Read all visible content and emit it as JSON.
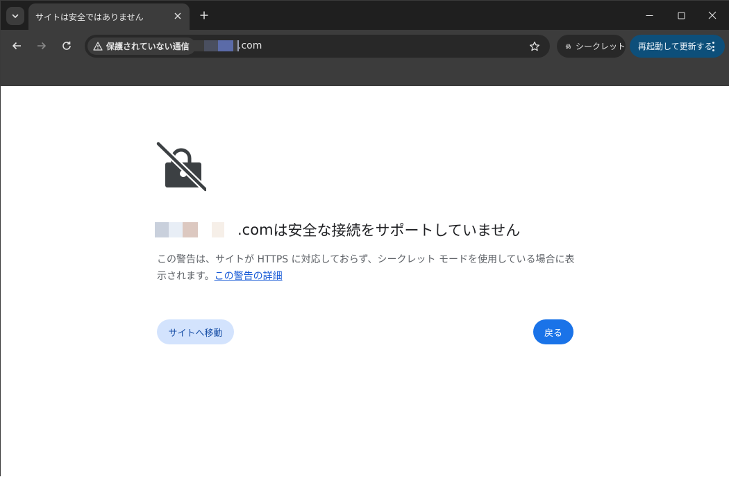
{
  "tabbar": {
    "tab_title": "サイトは安全ではありません",
    "icons": [
      "chevron-down-icon",
      "close-icon",
      "plus-icon",
      "minimize-icon",
      "maximize-icon",
      "close-icon"
    ]
  },
  "toolbar": {
    "security_chip_label": "保護されていない通信",
    "url_suffix": ".com",
    "incognito_label": "シークレット",
    "relaunch_label": "再起動して更新する"
  },
  "interstitial": {
    "domain_suffix": ".com",
    "heading_rest": " は安全な接続をサポートしていません",
    "description_text": "この警告は、サイトが HTTPS に対応しておらず、シークレット モードを使用している場合に表示されます。",
    "learn_more_link": "この警告の詳細",
    "proceed_button": "サイトへ移動",
    "back_button": "戻る"
  },
  "colors": {
    "tabbar_bg": "#1f1f1f",
    "toolbar_bg": "#3c3c3c",
    "omnibox_bg": "#282828",
    "relaunch_bg": "#0d4f7a",
    "primary_button": "#1a73e8",
    "secondary_button": "#d3e3fd",
    "link": "#1558d6"
  }
}
